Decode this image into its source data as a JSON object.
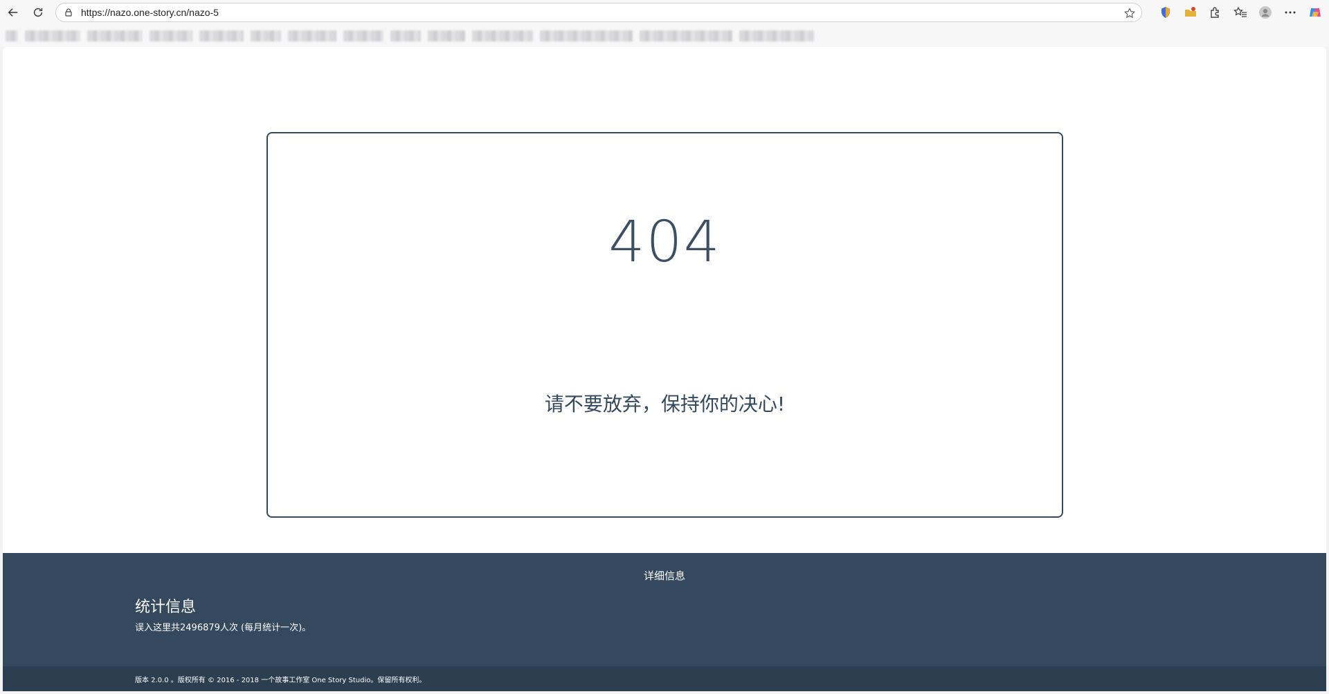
{
  "browser": {
    "url": "https://nazo.one-story.cn/nazo-5",
    "back_icon": "back-arrow-icon",
    "reload_icon": "reload-icon",
    "lock_icon": "lock-icon",
    "favorite_icon": "star-icon",
    "toolbar_icons": [
      "extension-shield-icon",
      "extension-folder-icon",
      "extensions-puzzle-icon",
      "favorites-icon",
      "profile-avatar-icon",
      "more-menu-icon",
      "copilot-icon"
    ]
  },
  "error_card": {
    "code": "404",
    "message": "请不要放弃，保持你的决心!"
  },
  "footer": {
    "heading": "详细信息",
    "stats_title": "统计信息",
    "stats_text": "误入这里共2496879人次 (每月统计一次)。",
    "copyright": "版本 2.0.0 。版权所有 © 2016 - 2018 一个故事工作室 One Story Studio。保留所有权利。"
  },
  "colors": {
    "primary": "#34495e",
    "footer_bottom": "#2c3e50",
    "page_bg": "#ffffff"
  }
}
